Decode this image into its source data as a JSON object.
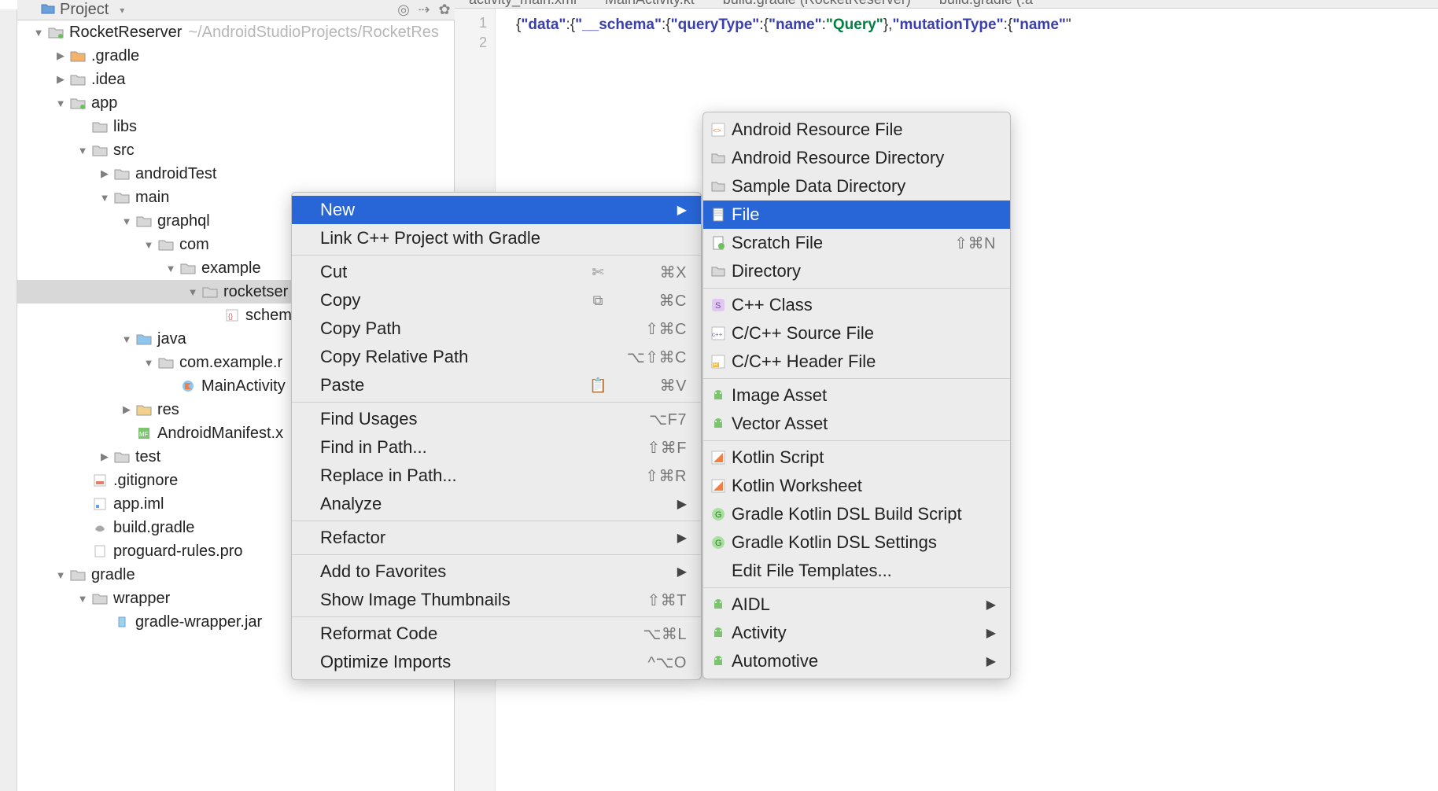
{
  "project_header": {
    "label": "Project"
  },
  "editor": {
    "tabs": [
      "activity_main.xml",
      "MainActivity.kt",
      "build.gradle (RocketReserver)",
      "build.gradle (:a"
    ],
    "line_numbers": [
      "1",
      "2"
    ],
    "code_tokens": [
      {
        "t": "brace",
        "v": "{"
      },
      {
        "t": "key",
        "v": "\"data\""
      },
      {
        "t": "brace",
        "v": ":{"
      },
      {
        "t": "key",
        "v": "\"__schema\""
      },
      {
        "t": "brace",
        "v": ":{"
      },
      {
        "t": "key",
        "v": "\"queryType\""
      },
      {
        "t": "brace",
        "v": ":{"
      },
      {
        "t": "key",
        "v": "\"name\""
      },
      {
        "t": "brace",
        "v": ":"
      },
      {
        "t": "val",
        "v": "\"Query\""
      },
      {
        "t": "brace",
        "v": "},"
      },
      {
        "t": "key",
        "v": "\"mutationType\""
      },
      {
        "t": "brace",
        "v": ":{"
      },
      {
        "t": "key",
        "v": "\"name\""
      },
      {
        "t": "brace",
        "v": "\""
      }
    ]
  },
  "tree": [
    {
      "indent": 0,
      "arrow": "down",
      "icon": "module",
      "label": "RocketReserver",
      "path": "~/AndroidStudioProjects/RocketRes"
    },
    {
      "indent": 1,
      "arrow": "right",
      "icon": "folder-orange",
      "label": ".gradle"
    },
    {
      "indent": 1,
      "arrow": "right",
      "icon": "folder",
      "label": ".idea"
    },
    {
      "indent": 1,
      "arrow": "down",
      "icon": "module",
      "label": "app"
    },
    {
      "indent": 2,
      "arrow": "",
      "icon": "folder",
      "label": "libs"
    },
    {
      "indent": 2,
      "arrow": "down",
      "icon": "folder",
      "label": "src"
    },
    {
      "indent": 3,
      "arrow": "right",
      "icon": "folder",
      "label": "androidTest"
    },
    {
      "indent": 3,
      "arrow": "down",
      "icon": "folder",
      "label": "main"
    },
    {
      "indent": 4,
      "arrow": "down",
      "icon": "folder",
      "label": "graphql"
    },
    {
      "indent": 5,
      "arrow": "down",
      "icon": "folder",
      "label": "com"
    },
    {
      "indent": 6,
      "arrow": "down",
      "icon": "folder",
      "label": "example"
    },
    {
      "indent": 7,
      "arrow": "down",
      "icon": "folder",
      "label": "rocketser",
      "selected": true
    },
    {
      "indent": 8,
      "arrow": "",
      "icon": "json",
      "label": "schem"
    },
    {
      "indent": 4,
      "arrow": "down",
      "icon": "folder-src",
      "label": "java"
    },
    {
      "indent": 5,
      "arrow": "down",
      "icon": "package",
      "label": "com.example.r"
    },
    {
      "indent": 6,
      "arrow": "",
      "icon": "kotlin",
      "label": "MainActivity"
    },
    {
      "indent": 4,
      "arrow": "right",
      "icon": "folder-res",
      "label": "res"
    },
    {
      "indent": 4,
      "arrow": "",
      "icon": "manifest",
      "label": "AndroidManifest.x"
    },
    {
      "indent": 3,
      "arrow": "right",
      "icon": "folder",
      "label": "test"
    },
    {
      "indent": 2,
      "arrow": "",
      "icon": "gitignore",
      "label": ".gitignore"
    },
    {
      "indent": 2,
      "arrow": "",
      "icon": "iml",
      "label": "app.iml"
    },
    {
      "indent": 2,
      "arrow": "",
      "icon": "gradle",
      "label": "build.gradle"
    },
    {
      "indent": 2,
      "arrow": "",
      "icon": "file",
      "label": "proguard-rules.pro"
    },
    {
      "indent": 1,
      "arrow": "down",
      "icon": "folder",
      "label": "gradle"
    },
    {
      "indent": 2,
      "arrow": "down",
      "icon": "folder",
      "label": "wrapper"
    },
    {
      "indent": 3,
      "arrow": "",
      "icon": "jar",
      "label": "gradle-wrapper.jar"
    }
  ],
  "context_menu": [
    {
      "label": "New",
      "sub": true,
      "selected": true
    },
    {
      "label": "Link C++ Project with Gradle"
    },
    {
      "sep": true
    },
    {
      "label": "Cut",
      "short": "⌘X",
      "icon": "cut"
    },
    {
      "label": "Copy",
      "short": "⌘C",
      "icon": "copy"
    },
    {
      "label": "Copy Path",
      "short": "⇧⌘C"
    },
    {
      "label": "Copy Relative Path",
      "short": "⌥⇧⌘C"
    },
    {
      "label": "Paste",
      "short": "⌘V",
      "icon": "paste"
    },
    {
      "sep": true
    },
    {
      "label": "Find Usages",
      "short": "⌥F7"
    },
    {
      "label": "Find in Path...",
      "short": "⇧⌘F"
    },
    {
      "label": "Replace in Path...",
      "short": "⇧⌘R"
    },
    {
      "label": "Analyze",
      "sub": true
    },
    {
      "sep": true
    },
    {
      "label": "Refactor",
      "sub": true
    },
    {
      "sep": true
    },
    {
      "label": "Add to Favorites",
      "sub": true
    },
    {
      "label": "Show Image Thumbnails",
      "short": "⇧⌘T"
    },
    {
      "sep": true
    },
    {
      "label": "Reformat Code",
      "short": "⌥⌘L"
    },
    {
      "label": "Optimize Imports",
      "short": "^⌥O"
    }
  ],
  "new_submenu": [
    {
      "label": "Android Resource File",
      "icon": "xml"
    },
    {
      "label": "Android Resource Directory",
      "icon": "folder"
    },
    {
      "label": "Sample Data Directory",
      "icon": "folder"
    },
    {
      "label": "File",
      "icon": "file",
      "selected": true
    },
    {
      "label": "Scratch File",
      "icon": "scratch",
      "short": "⇧⌘N"
    },
    {
      "label": "Directory",
      "icon": "folder"
    },
    {
      "sep": true
    },
    {
      "label": "C++ Class",
      "icon": "cpp-class"
    },
    {
      "label": "C/C++ Source File",
      "icon": "cpp-src"
    },
    {
      "label": "C/C++ Header File",
      "icon": "cpp-h"
    },
    {
      "sep": true
    },
    {
      "label": "Image Asset",
      "icon": "android"
    },
    {
      "label": "Vector Asset",
      "icon": "android"
    },
    {
      "sep": true
    },
    {
      "label": "Kotlin Script",
      "icon": "kotlin-s"
    },
    {
      "label": "Kotlin Worksheet",
      "icon": "kotlin-s"
    },
    {
      "label": "Gradle Kotlin DSL Build Script",
      "icon": "gradle-g"
    },
    {
      "label": "Gradle Kotlin DSL Settings",
      "icon": "gradle-g"
    },
    {
      "label": "Edit File Templates..."
    },
    {
      "sep": true
    },
    {
      "label": "AIDL",
      "icon": "android",
      "sub": true
    },
    {
      "label": "Activity",
      "icon": "android",
      "sub": true
    },
    {
      "label": "Automotive",
      "icon": "android",
      "sub": true
    }
  ]
}
